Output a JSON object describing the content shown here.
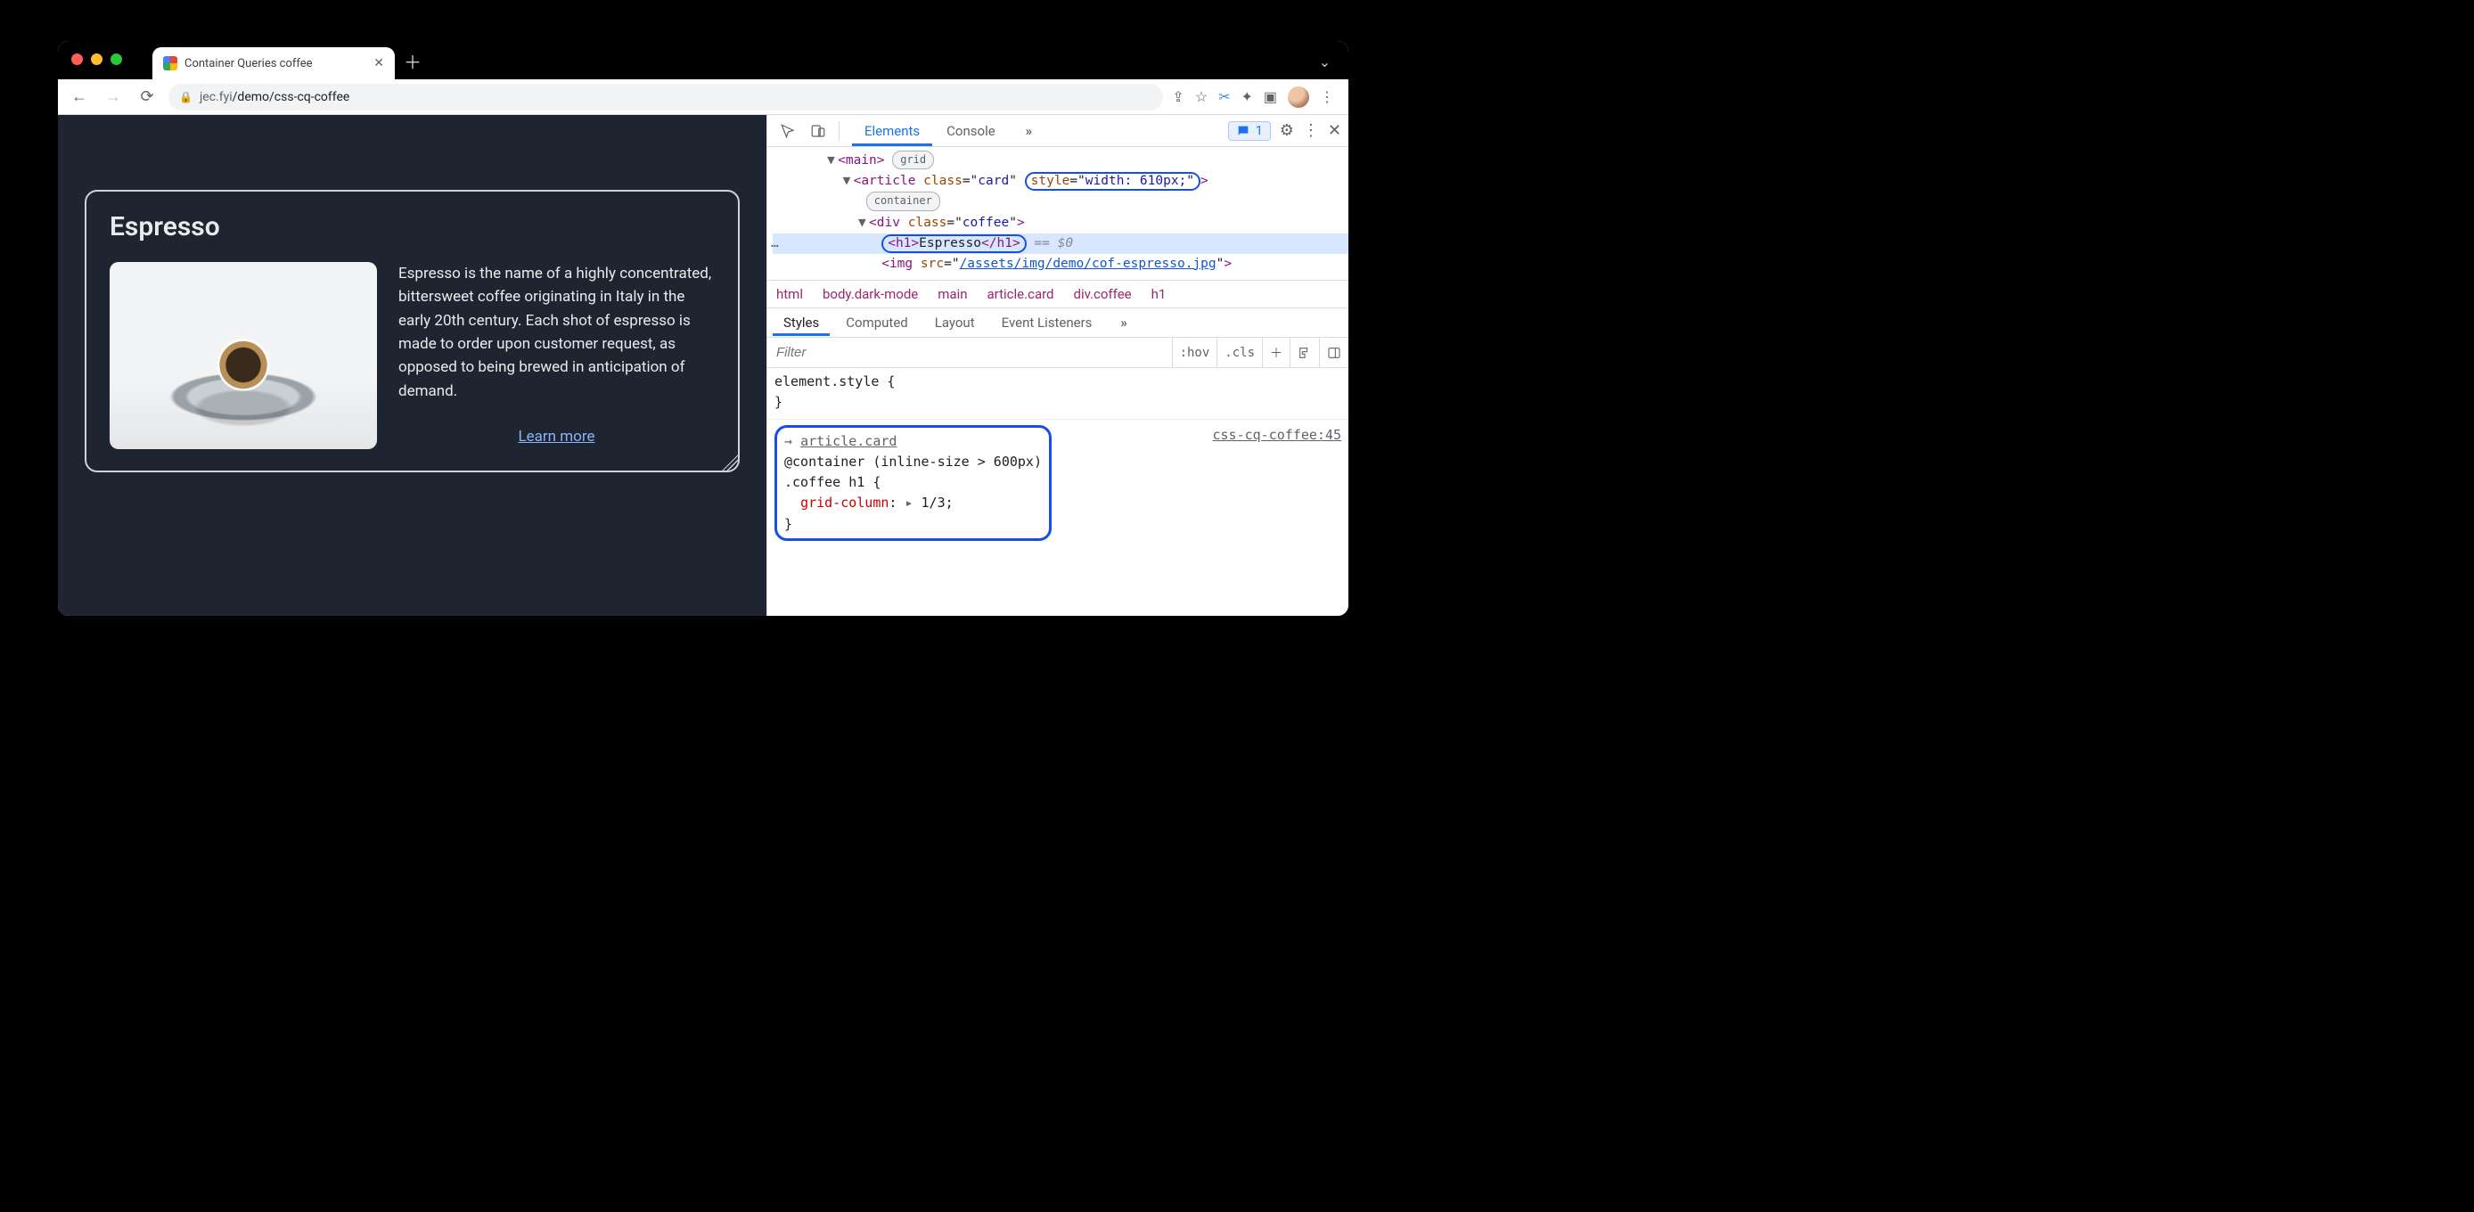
{
  "browser": {
    "tab_title": "Container Queries coffee",
    "url_host": "jec.fyi",
    "url_path": "/demo/css-cq-coffee",
    "issues_count": "1"
  },
  "devtools": {
    "tabs": {
      "elements": "Elements",
      "console": "Console"
    },
    "crumbs": [
      "html",
      "body.dark-mode",
      "main",
      "article.card",
      "div.coffee",
      "h1"
    ],
    "styles_tabs": {
      "styles": "Styles",
      "computed": "Computed",
      "layout": "Layout",
      "listeners": "Event Listeners"
    },
    "filter_placeholder": "Filter",
    "hov": ":hov",
    "cls": ".cls"
  },
  "dom": {
    "main_open": "main",
    "main_badge": "grid",
    "article_open": "article",
    "article_class_attr": "class",
    "article_class_val": "card",
    "article_style_attr": "style",
    "article_style_val": "width: 610px;",
    "article_badge": "container",
    "div_open": "div",
    "div_class_attr": "class",
    "div_class_val": "coffee",
    "h1_tag": "h1",
    "h1_text": "Espresso",
    "sel_eq": " == ",
    "sel_dollar": "$0",
    "img_tag": "img",
    "img_src_attr": "src",
    "img_src_val": "/assets/img/demo/cof-espresso.jpg"
  },
  "styles": {
    "element_style": "element.style {",
    "element_style_close": "}",
    "container_target": "article.card",
    "container_query": "@container (inline-size > 600px)",
    "rule_selector": ".coffee h1 {",
    "rule_prop": "grid-column",
    "rule_val": "1/3",
    "rule_close": "}",
    "source": "css-cq-coffee:45"
  },
  "page": {
    "heading": "Espresso",
    "body": "Espresso is the name of a highly concentrated, bittersweet coffee originating in Italy in the early 20th century. Each shot of espresso is made to order upon customer request, as opposed to being brewed in anticipation of demand.",
    "learn_more": "Learn more"
  }
}
